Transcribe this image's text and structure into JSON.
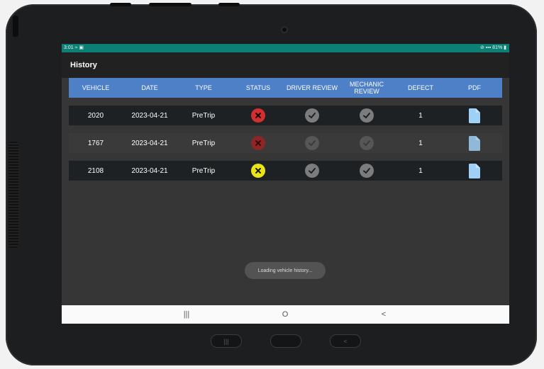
{
  "status_bar": {
    "time": "3:01",
    "left_icons": [
      "wifi-icon",
      "image-icon"
    ],
    "right_text": "81%",
    "right_icons": [
      "mute-icon",
      "signal-icon",
      "battery-icon"
    ]
  },
  "app": {
    "title": "History"
  },
  "table": {
    "columns": [
      "VEHICLE",
      "DATE",
      "TYPE",
      "STATUS",
      "DRIVER REVIEW",
      "MECHANIC REVIEW",
      "DEFECT",
      "PDF"
    ],
    "rows": [
      {
        "vehicle": "2020",
        "date": "2023-04-21",
        "type": "PreTrip",
        "status": "failed",
        "driver_review": "reviewed",
        "mechanic_review": "reviewed",
        "defect": "1",
        "pdf": "pdf-file-icon"
      },
      {
        "vehicle": "1767",
        "date": "2023-04-21",
        "type": "PreTrip",
        "status": "failed",
        "driver_review": "reviewed",
        "mechanic_review": "reviewed",
        "defect": "1",
        "pdf": "pdf-file-icon"
      },
      {
        "vehicle": "2108",
        "date": "2023-04-21",
        "type": "PreTrip",
        "status": "warning",
        "driver_review": "reviewed",
        "mechanic_review": "reviewed",
        "defect": "1",
        "pdf": "pdf-file-icon"
      }
    ]
  },
  "toast": {
    "text": "Loading vehicle history..."
  },
  "nav_bar": {
    "recents": "|||",
    "home": "O",
    "back": "<"
  },
  "hardware_buttons": {
    "recents": "|||",
    "back": "<"
  },
  "colors": {
    "status_bar": "#0d8075",
    "header": "#4e80c8",
    "failed": "#d32f2f",
    "warning": "#e9e417",
    "check": "#7c7c7c",
    "pdf": "#9fd0f5"
  }
}
